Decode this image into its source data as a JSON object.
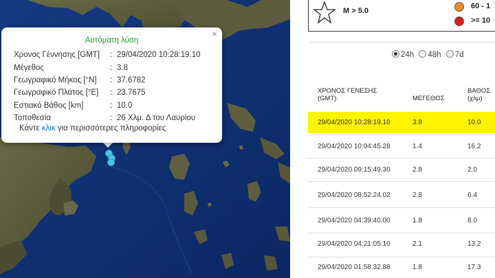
{
  "popup": {
    "close_glyph": "×",
    "title": "Αυτόματη λύση",
    "rows": [
      {
        "label": "Χρονος Γέννησης [GMT]",
        "value": "29/04/2020 10:28:19.10"
      },
      {
        "label": "Μέγεθος",
        "value": "3.8"
      },
      {
        "label": "Γεωγραφικό Μήκος [°N]",
        "value": "37.6782"
      },
      {
        "label": "Γεωγραφικό Πλάτος [°E]",
        "value": "23.7675"
      },
      {
        "label": "Εστιακό Βάθος [km]",
        "value": "10.0"
      },
      {
        "label": "Τοποθεσία",
        "value": "26 Χλμ. Δ του Λαυρίου"
      }
    ],
    "separator": ":",
    "more_prefix": "Κάντε ",
    "more_link": "κλικ",
    "more_suffix": " για περισσότερες πληροφορίες"
  },
  "legend": {
    "star_label": "M > 5.0",
    "items": [
      {
        "label": "60 - 1",
        "color": "#f28c28"
      },
      {
        "label": ">= 10",
        "color": "#e0191f"
      }
    ]
  },
  "range_options": [
    {
      "label": "24h",
      "selected": true
    },
    {
      "label": "48h",
      "selected": false
    },
    {
      "label": "7d",
      "selected": false
    }
  ],
  "table": {
    "headers": {
      "time_line1": "ΧΡΟΝΟΣ ΓΕΝΕΣΗΣ",
      "time_line2": "(GMT)",
      "magnitude": "ΜΕΓΕΘΟΣ",
      "depth_line1": "ΒΑΘΟΣ",
      "depth_line2": "(χλμ)"
    },
    "rows": [
      {
        "time": "29/04/2020 10:28:19.10",
        "mag": "3.8",
        "depth": "10.0",
        "selected": true
      },
      {
        "time": "29/04/2020 10:04:45.28",
        "mag": "1.4",
        "depth": "16.2",
        "selected": false
      },
      {
        "time": "29/04/2020 09:15:49.30",
        "mag": "2.8",
        "depth": "2.0",
        "selected": false
      },
      {
        "time": "29/04/2020 08:52:24.02",
        "mag": "2.8",
        "depth": "6.4",
        "selected": false
      },
      {
        "time": "29/04/2020 04:39:40.00",
        "mag": "1.8",
        "depth": "8.0",
        "selected": false
      },
      {
        "time": "29/04/2020 04:21:05.10",
        "mag": "2.1",
        "depth": "13.2",
        "selected": false
      },
      {
        "time": "29/04/2020 01:58:32.88",
        "mag": "1.8",
        "depth": "17.3",
        "selected": false
      }
    ]
  },
  "colors": {
    "sea": "#0f2f72",
    "land": "#5a5a3e",
    "quake_marker": "#4ec3e6",
    "popup_title": "#1f9a2c",
    "link": "#1670c7",
    "selected_row": "#fff300"
  }
}
